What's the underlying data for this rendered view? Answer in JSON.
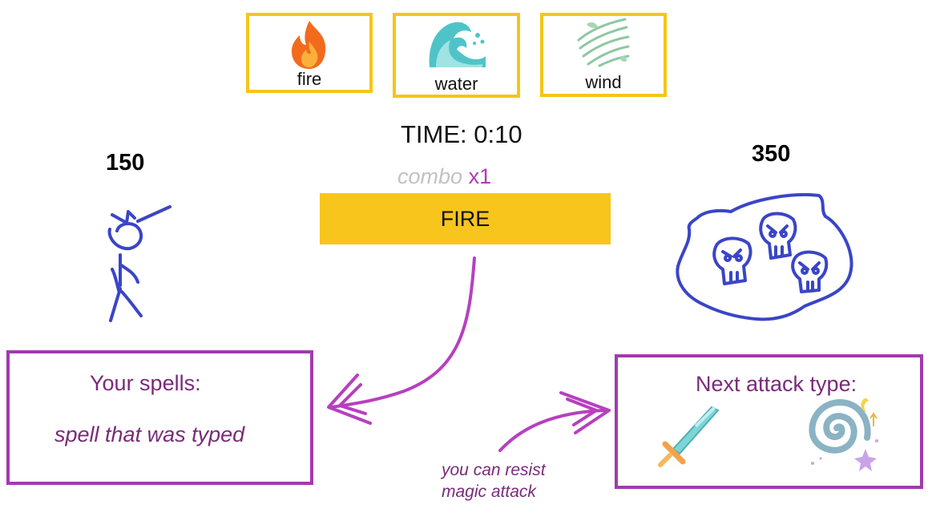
{
  "elements": {
    "fire": "fire",
    "water": "water",
    "wind": "wind"
  },
  "hud": {
    "timer": "TIME: 0:10",
    "player_score": "150",
    "enemy_score": "350",
    "combo_word": "combo",
    "combo_mult": "x1",
    "prompt": "FIRE"
  },
  "spells_panel": {
    "title": "Your spells:",
    "typed": "spell that was typed"
  },
  "attack_panel": {
    "title": "Next attack type:"
  },
  "note": {
    "line1": "you can resist",
    "line2": "magic attack"
  },
  "colors": {
    "card_border": "#f5c518",
    "prompt_bg": "#f8c51c",
    "panel_border": "#a23aae",
    "ink_blue": "#3a45c8",
    "combo_accent": "#b03ab8"
  },
  "icons": {
    "fire": "fire-icon",
    "water": "wave-icon",
    "wind": "wind-icon",
    "player": "stick-figure-wizard",
    "enemy": "skull-cloud",
    "physical_attack": "sword-icon",
    "magic_attack": "magic-spiral-icon"
  }
}
